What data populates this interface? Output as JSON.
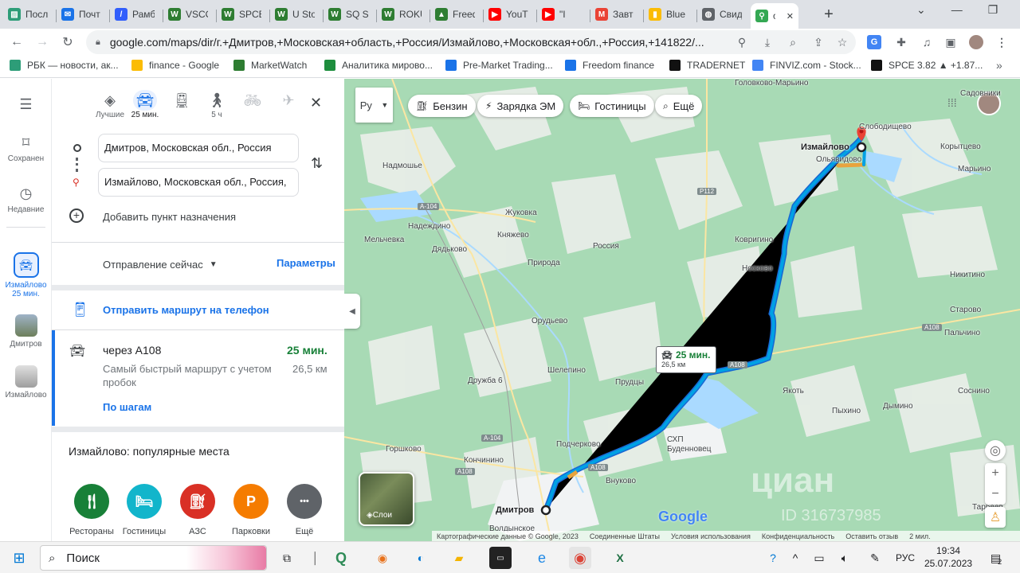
{
  "tabs": [
    {
      "title": "Посл",
      "icon": "photo-icon",
      "color": "#2d9d78"
    },
    {
      "title": "Почт",
      "icon": "mail-icon",
      "color": "#1a73e8"
    },
    {
      "title": "Рамб",
      "icon": "rambler-icon",
      "color": "#315efb"
    },
    {
      "title": "VSCO",
      "icon": "marketwatch-icon",
      "color": "#2e7d32"
    },
    {
      "title": "SPCE",
      "icon": "marketwatch-icon",
      "color": "#2e7d32"
    },
    {
      "title": "U Sto",
      "icon": "marketwatch-icon",
      "color": "#2e7d32"
    },
    {
      "title": "SQ St",
      "icon": "marketwatch-icon",
      "color": "#2e7d32"
    },
    {
      "title": "ROKU",
      "icon": "marketwatch-icon",
      "color": "#2e7d32"
    },
    {
      "title": "Freed",
      "icon": "freedom-icon",
      "color": "#2e7d32"
    },
    {
      "title": "YouT",
      "icon": "youtube-icon",
      "color": "#ff0000"
    },
    {
      "title": "\"I",
      "icon": "youtube-icon",
      "color": "#ff0000"
    },
    {
      "title": "Завт",
      "icon": "gmail-icon",
      "color": "#ea4335"
    },
    {
      "title": "Blue",
      "icon": "chart-icon",
      "color": "#fbbc04"
    },
    {
      "title": "Свид",
      "icon": "globe-icon",
      "color": "#5f6368"
    },
    {
      "title": "о",
      "icon": "maps-icon",
      "color": "#34a853"
    }
  ],
  "url": "google.com/maps/dir/г.+Дмитров,+Московская+область,+Россия/Измайлово,+Московская+обл.,+Россия,+141822/...",
  "bookmarks": [
    {
      "label": "РБК — новости, ак...",
      "color": "#2d9d78"
    },
    {
      "label": "finance - Google",
      "color": "#fbbc04"
    },
    {
      "label": "MarketWatch",
      "color": "#2e7d32"
    },
    {
      "label": "Аналитика мирово...",
      "color": "#1e8e3e"
    },
    {
      "label": "Pre-Market Trading...",
      "color": "#1a73e8"
    },
    {
      "label": "Freedom finance",
      "color": "#1a73e8"
    },
    {
      "label": "TRADERNET",
      "color": "#111111"
    },
    {
      "label": "FINVIZ.com - Stock...",
      "color": "#4285f4"
    },
    {
      "label": "SPCE 3.82 ▲ +1.87...",
      "color": "#111111"
    }
  ],
  "rail": {
    "saved": "Сохранен",
    "recent": "Недавние",
    "izmaylovo_trip": "Измайлово",
    "izmaylovo_time": "25 мин.",
    "dmitrov": "Дмитров",
    "izmaylovo2": "Измайлово"
  },
  "modes": {
    "best": "Лучшие",
    "car": "25 мин.",
    "walk": "5 ч"
  },
  "directions": {
    "from": "Дмитров, Московская обл., Россия",
    "to": "Измайлово, Московская обл., Россия,",
    "add_dest": "Добавить пункт назначения",
    "depart": "Отправление сейчас",
    "params": "Параметры",
    "send": "Отправить маршрут на телефон"
  },
  "route": {
    "via": "через А108",
    "time": "25 мин.",
    "desc": "Самый быстрый маршрут с учетом пробок",
    "dist": "26,5 км",
    "steps": "По шагам"
  },
  "popular": {
    "title": "Измайлово: популярные места",
    "items": [
      {
        "label": "Рестораны",
        "icon": "restaurant-icon",
        "color": "#188038"
      },
      {
        "label": "Гостиницы",
        "icon": "hotel-icon",
        "color": "#12b5cb"
      },
      {
        "label": "АЗС",
        "icon": "gas-icon",
        "color": "#d93025"
      },
      {
        "label": "Парковки",
        "icon": "parking-icon",
        "color": "#f57c00"
      },
      {
        "label": "Ещё",
        "icon": "more-icon",
        "color": "#5f6368"
      }
    ]
  },
  "map": {
    "chips": [
      {
        "label": "Бензин"
      },
      {
        "label": "Зарядка ЭМ"
      },
      {
        "label": "Гостиницы"
      },
      {
        "label": "Ещё"
      }
    ],
    "route_time": "25 мин.",
    "route_dist": "26,5 км",
    "layers": "Слои",
    "brand": "Google",
    "footer": [
      "Картографические данные © Google, 2023",
      "Соединенные Штаты",
      "Условия использования",
      "Конфиденциальность",
      "Оставить отзыв",
      "2 мил."
    ],
    "watermark": "циан",
    "watermark_id": "ID 316737985",
    "places": [
      {
        "name": "Измайлово",
        "bold": true
      },
      {
        "name": "Слободищево"
      },
      {
        "name": "Корытцево"
      },
      {
        "name": "Ольявидово"
      },
      {
        "name": "Марьино"
      },
      {
        "name": "Надмошье"
      },
      {
        "name": "Жуковка"
      },
      {
        "name": "Надеждино"
      },
      {
        "name": "Княжево"
      },
      {
        "name": "Мельчевка"
      },
      {
        "name": "Дядьково"
      },
      {
        "name": "Россия"
      },
      {
        "name": "Природа"
      },
      {
        "name": "Ковригино"
      },
      {
        "name": "Носково"
      },
      {
        "name": "Никитино"
      },
      {
        "name": "Старово"
      },
      {
        "name": "Пальчино"
      },
      {
        "name": "Орудьево"
      },
      {
        "name": "Шелепино"
      },
      {
        "name": "Прудцы"
      },
      {
        "name": "Дружба 6"
      },
      {
        "name": "Якоть"
      },
      {
        "name": "Дымино"
      },
      {
        "name": "Пыхино"
      },
      {
        "name": "Соснино"
      },
      {
        "name": "СХП Буденновец"
      },
      {
        "name": "Подчерково"
      },
      {
        "name": "Горшково"
      },
      {
        "name": "Кончинино"
      },
      {
        "name": "Внуково"
      },
      {
        "name": "Дмитров",
        "bold": true
      },
      {
        "name": "Волдынское"
      },
      {
        "name": "Тарбеев"
      },
      {
        "name": "Садовники"
      },
      {
        "name": "Головково-Марьино"
      }
    ],
    "roads": [
      "А-104",
      "Р112",
      "А108",
      "А-104",
      "А108",
      "А108",
      "А108"
    ]
  },
  "taskbar": {
    "search": "Поиск",
    "lang": "РУС",
    "time": "19:34",
    "date": "25.07.2023",
    "notif": "2"
  }
}
